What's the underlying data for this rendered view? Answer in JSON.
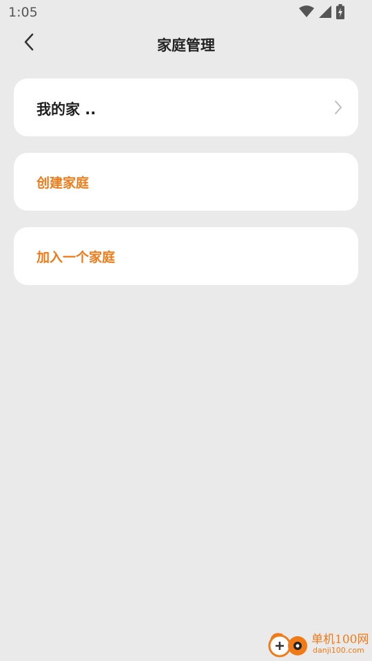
{
  "status_bar": {
    "time": "1:05",
    "icons": [
      "wifi-icon",
      "signal-icon",
      "battery-charging-icon"
    ]
  },
  "header": {
    "title": "家庭管理",
    "back_icon": "chevron-left-icon"
  },
  "cards": {
    "home": {
      "label": "我的家 .."
    },
    "create": {
      "label": "创建家庭"
    },
    "join": {
      "label": "加入一个家庭"
    }
  },
  "colors": {
    "accent": "#F07A17",
    "background": "#EAEAEA",
    "card": "#FFFFFF",
    "text": "#1F1F1F"
  },
  "watermark": {
    "title": "单机100网",
    "url": "danji100.com"
  }
}
